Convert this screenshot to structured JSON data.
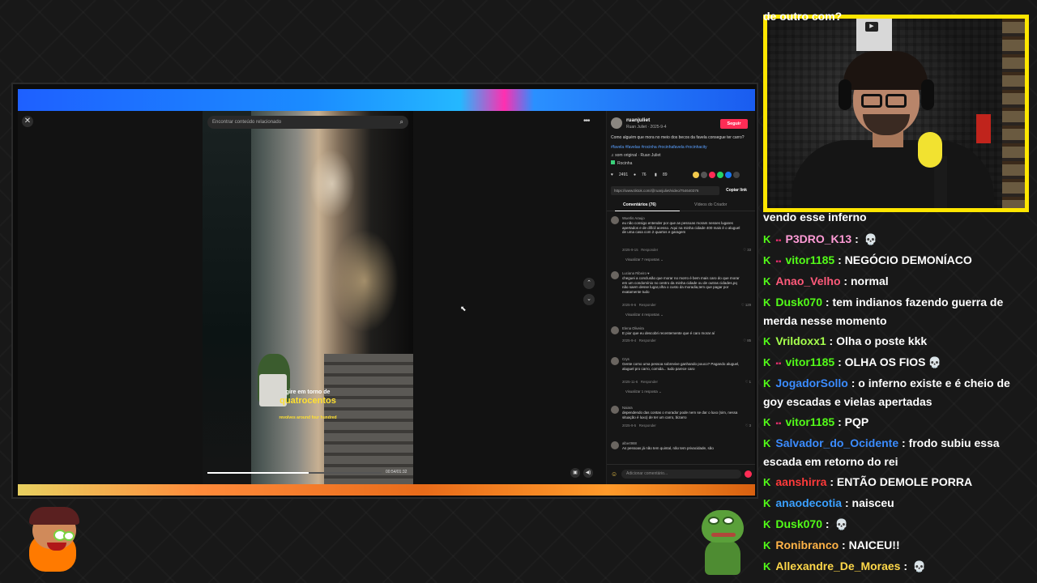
{
  "tiktok": {
    "search_placeholder": "Encontrar conteúdo relacionado",
    "close_icon": "close-icon",
    "video": {
      "subtitle_line1": "gire em torno de",
      "subtitle_line2": "quatrocentos",
      "subtitle_line3": "revolves around four hundred",
      "time": "00:54/01:32",
      "progress_fraction": 0.58
    },
    "panel": {
      "username": "ruanjuliet",
      "user_sub": "Ruan Juliet · 2025-9-4",
      "follow_label": "Seguir",
      "caption": "Como alguém que mora no meio dos becos da favela consegue ter carro?",
      "hashtags": "#favela #favelas #rocinha #rocinhafavela #rocinhacity",
      "music": "♫ som original · Ruan Juliet",
      "location": "Rocinha",
      "stats": {
        "likes": "2491",
        "comments": "76",
        "saves": "89"
      },
      "link": "https://www.tiktok.com/@ruanjuliet/video/754640376",
      "copy_label": "Copiar link",
      "tab_comments": "Comentários (76)",
      "tab_creator": "Vídeos do Criador",
      "add_comment_placeholder": "Adicionar comentário...",
      "comments": [
        {
          "name": "Wuerlis Araujo",
          "text": "eu não consigo entender por que as pessoas moram nesses lugares apertados e de difícil acesso. Aqui na minha cidade 400 mais é o aluguel de uma casa com 2 quartos e garagem",
          "date": "2025-9-15",
          "reply": "Responder",
          "likes": "33",
          "replies": "Visualizar 7 respostas ⌄"
        },
        {
          "name": "Luciana Ribeiro ♥",
          "text": "cheguei a conclusão que morar no morro é bem mais caro do que morar em um condomínio no centro da minha cidade ou de outras cidades,pq não saem desse lugar,olha o custo da moradia,tem que pagar por exatamente tudo",
          "date": "2025-9-6",
          "reply": "Responder",
          "likes": "129",
          "replies": "Visualizar 4 respostas ⌄"
        },
        {
          "name": "Elena Oliveira",
          "text": "E pior que eu descobri recentemente que é caro morar aí",
          "date": "2025-9-4",
          "reply": "Responder",
          "likes": "85",
          "replies": ""
        },
        {
          "name": "Crys",
          "text": "Gente como uma pessoa sobrevive ganhando pouco? Pagando aluguel, aluguel pro carro, comida... tudo parece caro",
          "date": "2025-11-6",
          "reply": "Responder",
          "likes": "1",
          "replies": "Visualizar 1 resposta ⌄"
        },
        {
          "name": "Naiara",
          "text": "dependendo das contas o morador pode nem se dar o luxo (sim, nessa situação é luxo) de ter um carro, bizarro",
          "date": "2025-9-5",
          "reply": "Responder",
          "likes": "3",
          "replies": ""
        },
        {
          "name": "albert988",
          "text": "As pessoas já não tem quintal, não tem privacidade, são",
          "date": "",
          "reply": "",
          "likes": "",
          "replies": ""
        }
      ]
    }
  },
  "chat": {
    "top_cut": "de outro com?",
    "continuation": "vendo esse inferno",
    "messages": [
      {
        "user": "P3DRO_K13",
        "color": "#ff9bd6",
        "bot": true,
        "text": "",
        "emote": "💀"
      },
      {
        "user": "vitor1185",
        "color": "#53fc18",
        "bot": true,
        "text": "NEGÓCIO DEMONÍACO",
        "emote": ""
      },
      {
        "user": "Anao_Velho",
        "color": "#ff5a7a",
        "bot": false,
        "text": "normal",
        "emote": ""
      },
      {
        "user": "Dusk070",
        "color": "#53fc18",
        "bot": false,
        "text": "tem indianos fazendo guerra de merda nesse momento",
        "emote": ""
      },
      {
        "user": "Vrildoxx1",
        "color": "#a6ff4d",
        "bot": false,
        "text": "Olha o poste kkk",
        "emote": ""
      },
      {
        "user": "vitor1185",
        "color": "#53fc18",
        "bot": true,
        "text": "OLHA OS FIOS",
        "emote": "💀"
      },
      {
        "user": "JogadorSollo",
        "color": "#3b8cff",
        "bot": false,
        "text": "o inferno existe e é cheio de goy escadas e vielas apertadas",
        "emote": ""
      },
      {
        "user": "vitor1185",
        "color": "#53fc18",
        "bot": true,
        "text": "PQP",
        "emote": ""
      },
      {
        "user": "Salvador_do_Ocidente",
        "color": "#3b8cff",
        "bot": false,
        "text": "frodo subiu essa escada em retorno do rei",
        "emote": ""
      },
      {
        "user": "aanshirra",
        "color": "#ff3a3a",
        "bot": false,
        "text": "ENTÃO DEMOLE PORRA",
        "emote": ""
      },
      {
        "user": "anaodecotia",
        "color": "#3ba0ff",
        "bot": false,
        "text": "naisceu",
        "emote": ""
      },
      {
        "user": "Dusk070",
        "color": "#53fc18",
        "bot": false,
        "text": "",
        "emote": "💀"
      },
      {
        "user": "Ronibranco",
        "color": "#ffb347",
        "bot": false,
        "text": "NAICEU!!",
        "emote": ""
      },
      {
        "user": "Allexandre_De_Moraes",
        "color": "#ffd84a",
        "bot": false,
        "text": "",
        "emote": "💀"
      }
    ]
  },
  "colors": {
    "webcam_border": "#ffe600",
    "follow_button": "#fe2c55",
    "kick_green": "#53fc18"
  }
}
